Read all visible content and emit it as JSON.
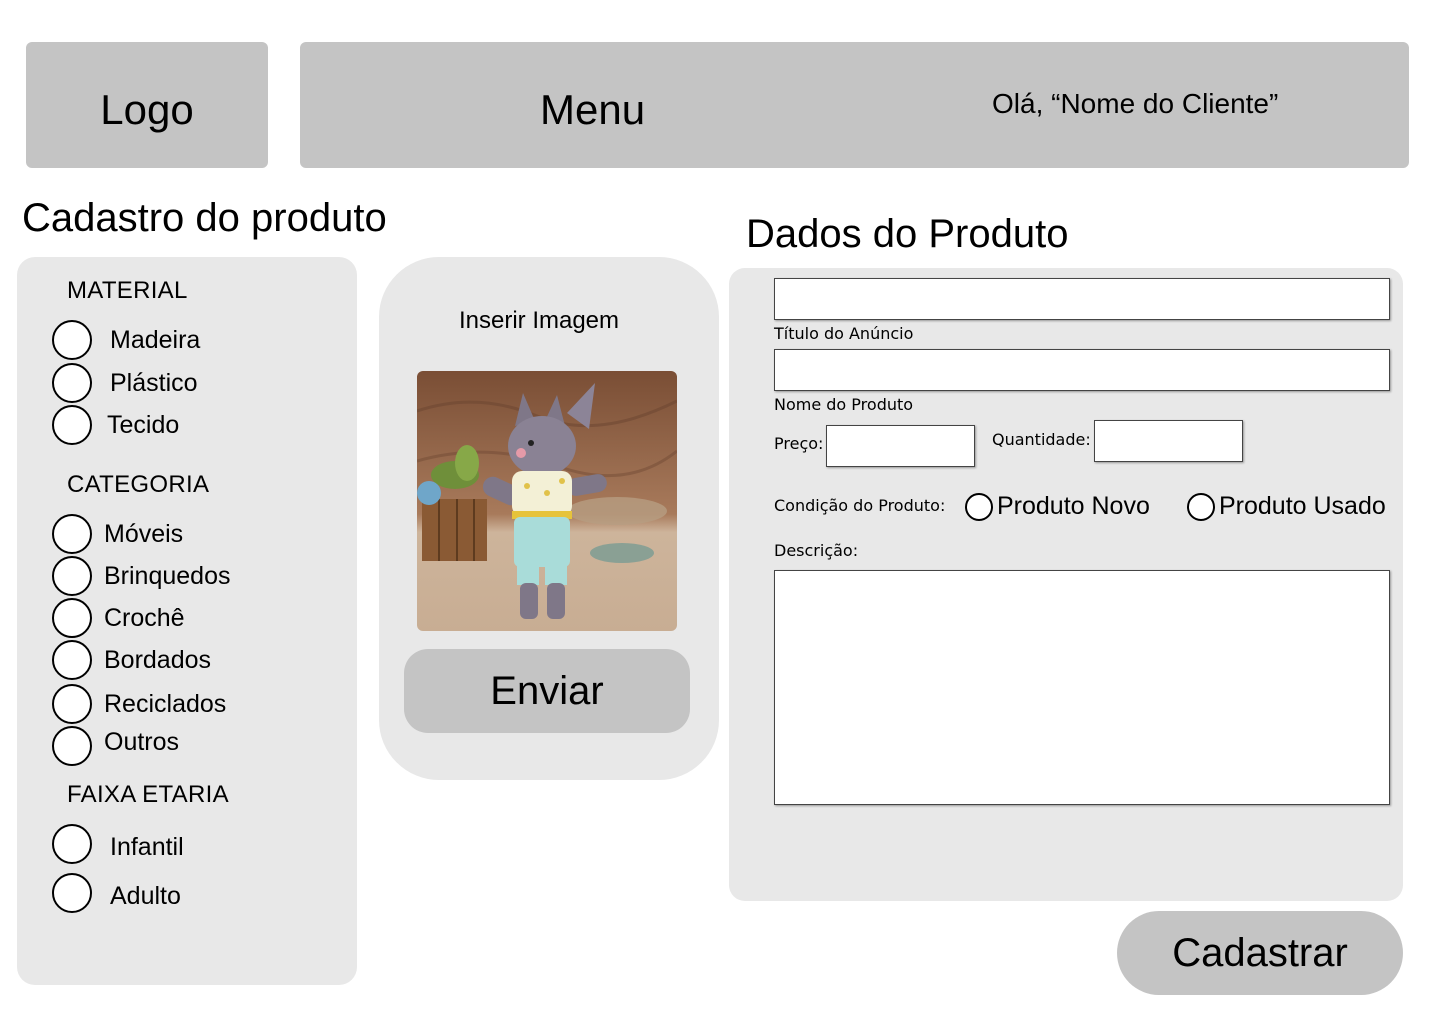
{
  "header": {
    "logo_label": "Logo",
    "menu_label": "Menu",
    "greeting": "Olá, “Nome do Cliente”"
  },
  "left": {
    "title": "Cadastro do produto",
    "material": {
      "label": "MATERIAL",
      "options": [
        "Madeira",
        "Plástico",
        "Tecido"
      ]
    },
    "categoria": {
      "label": "CATEGORIA",
      "options": [
        "Móveis",
        "Brinquedos",
        "Crochê",
        "Bordados",
        "Reciclados",
        "Outros"
      ]
    },
    "faixa_etaria": {
      "label": "FAIXA ETARIA",
      "options": [
        "Infantil",
        "Adulto"
      ]
    }
  },
  "image_upload": {
    "label": "Inserir Imagem",
    "image_icon": "crochet-toy-photo",
    "send_label": "Enviar"
  },
  "form": {
    "title": "Dados do Produto",
    "titulo_label": "Título do Anúncio",
    "titulo_value": "",
    "nome_label": "Nome do Produto",
    "nome_value": "",
    "preco_label": "Preço:",
    "preco_value": "",
    "quantidade_label": "Quantidade:",
    "quantidade_value": "",
    "condicao_label": "Condição do Produto:",
    "condicao_options": [
      "Produto Novo",
      "Produto Usado"
    ],
    "descricao_label": "Descrição:",
    "descricao_value": ""
  },
  "register_label": "Cadastrar",
  "colors": {
    "header_gray": "#c4c4c4",
    "panel_gray": "#e8e8e8",
    "background": "#ffffff"
  }
}
